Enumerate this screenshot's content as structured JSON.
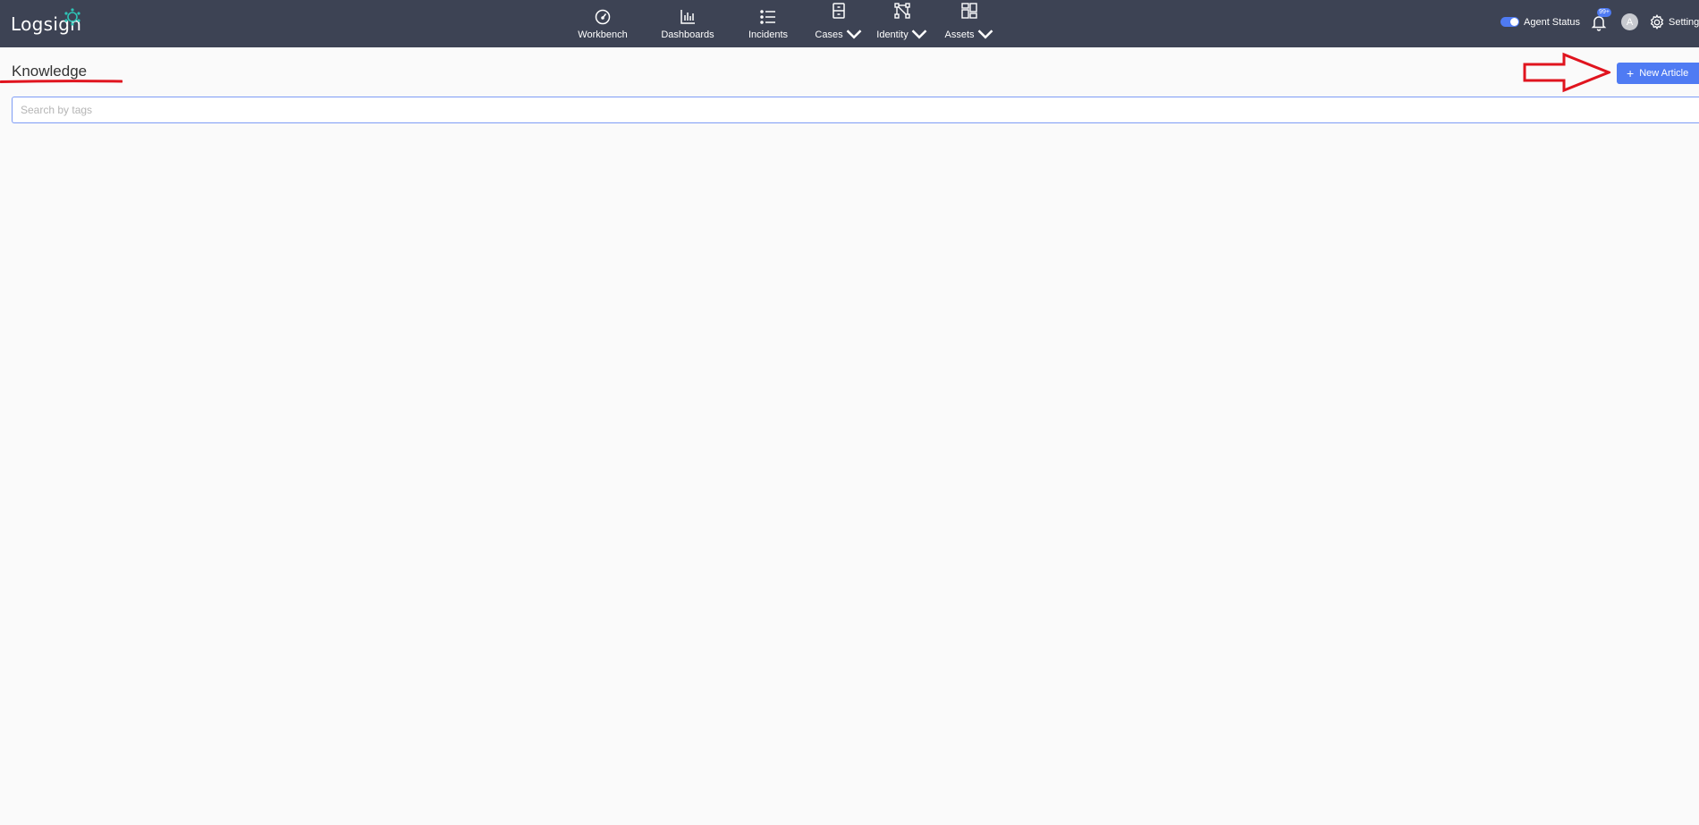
{
  "app": {
    "logo_text": "Logsign"
  },
  "nav": [
    {
      "label": "Workbench",
      "icon": "gauge-icon"
    },
    {
      "label": "Dashboards",
      "icon": "bar-chart-icon"
    },
    {
      "label": "Incidents",
      "icon": "list-icon"
    },
    {
      "label": "Cases",
      "icon": "cabinet-icon",
      "dropdown": true
    },
    {
      "label": "Identity",
      "icon": "nodes-icon",
      "dropdown": true
    },
    {
      "label": "Assets",
      "icon": "grid-icon",
      "dropdown": true
    }
  ],
  "header_right": {
    "agent_status_label": "Agent Status",
    "agent_status_on": true,
    "notifications_badge": "99+",
    "avatar_initial": "A",
    "settings_label": "Settings"
  },
  "page": {
    "title": "Knowledge",
    "new_article_label": "New Article",
    "search_placeholder": "Search by tags"
  },
  "colors": {
    "topbar": "#3d4354",
    "accent": "#4f7bf3",
    "annotation_red": "#e0141e",
    "background": "#fafafa"
  }
}
